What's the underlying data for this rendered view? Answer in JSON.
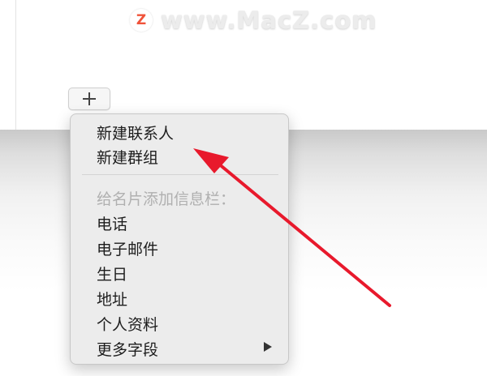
{
  "watermark": {
    "logo_letter": "Z",
    "text": "www.MacZ.com"
  },
  "add_button": {
    "icon": "plus-icon"
  },
  "menu": {
    "items": [
      {
        "label": "新建联系人"
      },
      {
        "label": "新建群组"
      }
    ],
    "section_header": "给名片添加信息栏：",
    "fields": [
      {
        "label": "电话"
      },
      {
        "label": "电子邮件"
      },
      {
        "label": "生日"
      },
      {
        "label": "地址"
      },
      {
        "label": "个人资料"
      },
      {
        "label": "更多字段",
        "submenu_icon": "chevron-right-icon"
      }
    ]
  },
  "colors": {
    "annotation_arrow": "#e8192c",
    "watermark_logo": "#f0533a"
  }
}
